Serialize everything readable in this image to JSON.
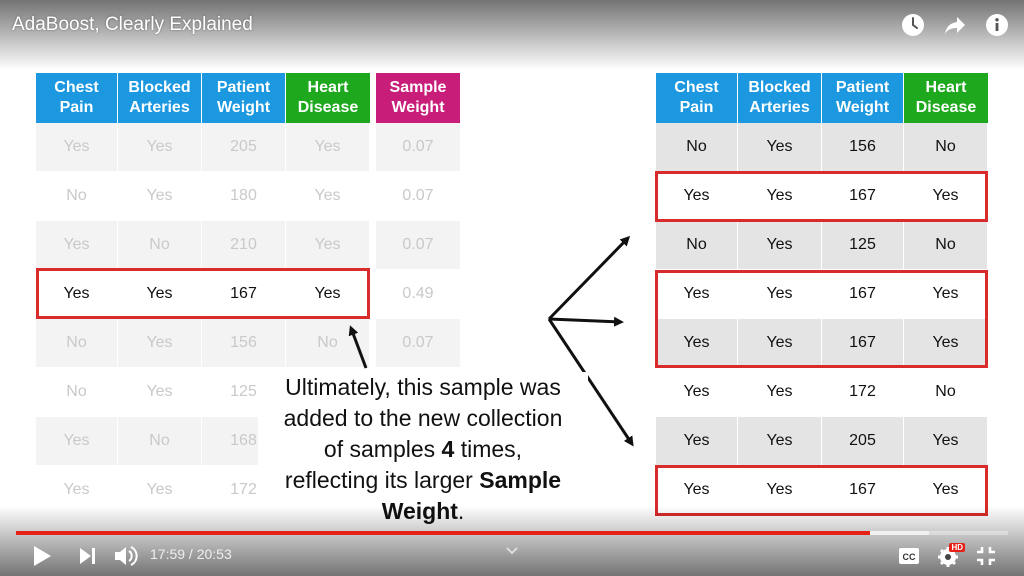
{
  "video": {
    "title": "AdaBoost, Clearly Explained",
    "current_time": "17:59",
    "time_sep": " / ",
    "duration": "20:53",
    "progress_fraction": 0.861,
    "buffer_fraction": 0.92
  },
  "icons": {
    "top": [
      "watch-later-icon",
      "share-icon",
      "info-icon"
    ],
    "bottom": [
      "play-icon",
      "next-icon",
      "volume-icon",
      "chevron-up-icon",
      "captions-icon",
      "settings-icon",
      "fullscreen-icon"
    ],
    "hd_badge": "HD"
  },
  "colors": {
    "header_blue": "#1b98e0",
    "header_green": "#1ea81e",
    "header_pink": "#c81e7a",
    "highlight_red": "#d82b2b",
    "progress_red": "#e62117"
  },
  "left_table": {
    "headers": [
      "Chest Pain",
      "Blocked Arteries",
      "Patient Weight",
      "Heart Disease"
    ],
    "rows": [
      [
        "Yes",
        "Yes",
        "205",
        "Yes"
      ],
      [
        "No",
        "Yes",
        "180",
        "Yes"
      ],
      [
        "Yes",
        "No",
        "210",
        "Yes"
      ],
      [
        "Yes",
        "Yes",
        "167",
        "Yes"
      ],
      [
        "No",
        "Yes",
        "156",
        "No"
      ],
      [
        "No",
        "Yes",
        "125",
        ""
      ],
      [
        "Yes",
        "No",
        "168",
        ""
      ],
      [
        "Yes",
        "Yes",
        "172",
        ""
      ]
    ],
    "selected_row": 3
  },
  "sample_weight": {
    "header": "Sample Weight",
    "values": [
      "0.07",
      "0.07",
      "0.07",
      "0.49",
      "0.07"
    ]
  },
  "right_table": {
    "headers": [
      "Chest Pain",
      "Blocked Arteries",
      "Patient Weight",
      "Heart Disease"
    ],
    "rows": [
      [
        "No",
        "Yes",
        "156",
        "No"
      ],
      [
        "Yes",
        "Yes",
        "167",
        "Yes"
      ],
      [
        "No",
        "Yes",
        "125",
        "No"
      ],
      [
        "Yes",
        "Yes",
        "167",
        "Yes"
      ],
      [
        "Yes",
        "Yes",
        "167",
        "Yes"
      ],
      [
        "Yes",
        "Yes",
        "172",
        "No"
      ],
      [
        "Yes",
        "Yes",
        "205",
        "Yes"
      ],
      [
        "Yes",
        "Yes",
        "167",
        "Yes"
      ]
    ]
  },
  "caption": {
    "line1": "Ultimately, this sample was",
    "line2": "added to the new collection",
    "line3_pre": "of samples ",
    "line3_bold": "4",
    "line3_post": " times,",
    "line4_pre": "reflecting its larger ",
    "line4_bold": "Sample",
    "line5_bold": "Weight",
    "line5_post": "."
  }
}
